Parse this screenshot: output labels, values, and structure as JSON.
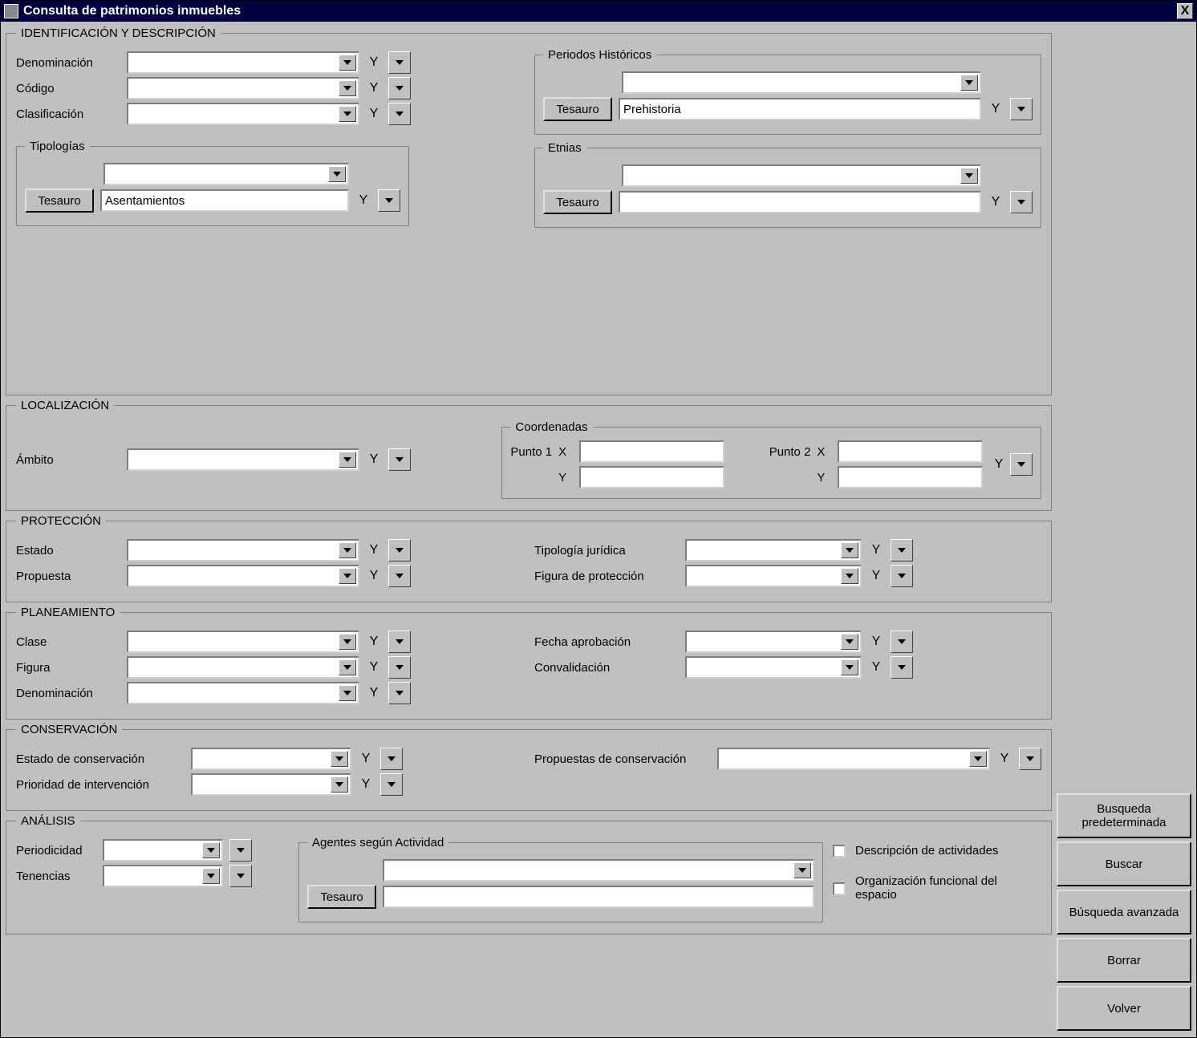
{
  "window": {
    "title": "Consulta de patrimonios inmuebles",
    "close": "X"
  },
  "op": {
    "y": "Y"
  },
  "ident": {
    "legend": "IDENTIFICACIÓN Y DESCRIPCIÓN",
    "denominacion_label": "Denominación",
    "denominacion_value": "",
    "codigo_label": "Código",
    "codigo_value": "",
    "clasificacion_label": "Clasificación",
    "clasificacion_value": "",
    "tipologias": {
      "legend": "Tipologías",
      "tesauro_btn": "Tesauro",
      "combo_value": "",
      "text_value": "Asentamientos"
    },
    "periodos": {
      "legend": "Periodos Históricos",
      "tesauro_btn": "Tesauro",
      "combo_value": "",
      "text_value": "Prehistoria"
    },
    "etnias": {
      "legend": "Etnias",
      "tesauro_btn": "Tesauro",
      "combo_value": "",
      "text_value": ""
    }
  },
  "loc": {
    "legend": "LOCALIZACIÓN",
    "ambito_label": "Ámbito",
    "ambito_value": "",
    "coords": {
      "legend": "Coordenadas",
      "p1_label": "Punto 1",
      "p2_label": "Punto 2",
      "x": "X",
      "y": "Y",
      "p1x": "",
      "p1y": "",
      "p2x": "",
      "p2y": ""
    }
  },
  "prot": {
    "legend": "PROTECCIÓN",
    "estado_label": "Estado",
    "estado_value": "",
    "propuesta_label": "Propuesta",
    "propuesta_value": "",
    "tipologia_label": "Tipología jurídica",
    "tipologia_value": "",
    "figura_label": "Figura de protección",
    "figura_value": ""
  },
  "plan": {
    "legend": "PLANEAMIENTO",
    "clase_label": "Clase",
    "clase_value": "",
    "figura_label": "Figura",
    "figura_value": "",
    "denom_label": "Denominación",
    "denom_value": "",
    "fecha_label": "Fecha aprobación",
    "fecha_value": "",
    "conval_label": "Convalidación",
    "conval_value": ""
  },
  "cons": {
    "legend": "CONSERVACIÓN",
    "estado_label": "Estado de conservación",
    "estado_value": "",
    "prioridad_label": "Prioridad de intervención",
    "prioridad_value": "",
    "propuestas_label": "Propuestas de conservación",
    "propuestas_value": ""
  },
  "anal": {
    "legend": "ANÁLISIS",
    "period_label": "Periodicidad",
    "period_value": "",
    "tenencias_label": "Tenencias",
    "tenencias_value": "",
    "agentes": {
      "legend": "Agentes según Actividad",
      "tesauro_btn": "Tesauro",
      "combo_value": "",
      "text_value": ""
    },
    "chk_desc": "Descripción de actividades",
    "chk_org": "Organización funcional del espacio"
  },
  "buttons": {
    "predef": "Busqueda predeterminada",
    "buscar": "Buscar",
    "avanzada": "Búsqueda avanzada",
    "borrar": "Borrar",
    "volver": "Volver"
  }
}
